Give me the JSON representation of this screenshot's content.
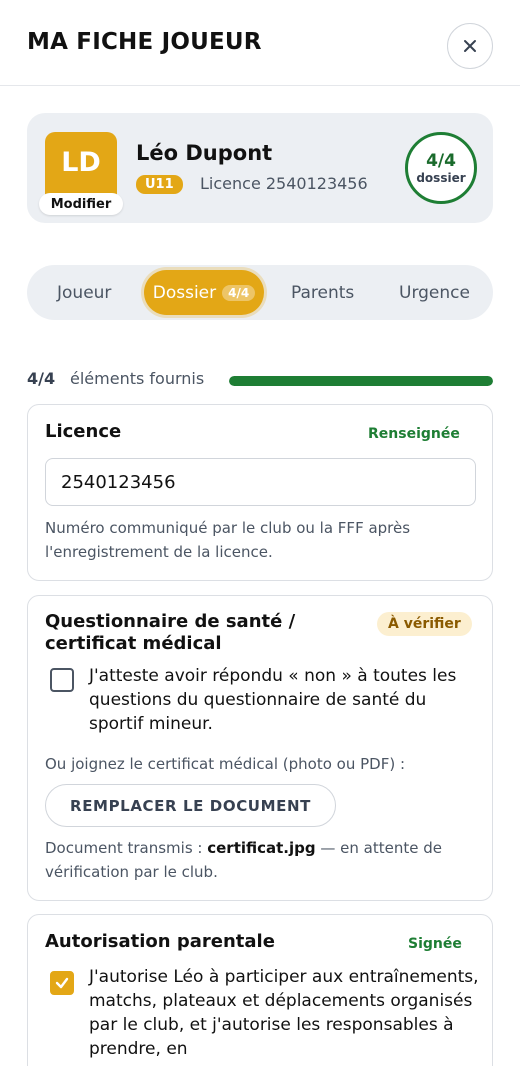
{
  "header": {
    "title": "MA FICHE JOUEUR",
    "close_icon": "close-icon"
  },
  "player": {
    "initials": "LD",
    "modify_label": "Modifier",
    "name": "Léo Dupont",
    "category": "U11",
    "licence_text": "Licence 2540123456",
    "progress_count": "4/4",
    "progress_label": "dossier"
  },
  "tabs": [
    {
      "label": "Joueur"
    },
    {
      "label": "Dossier",
      "count": "4/4",
      "active": true
    },
    {
      "label": "Parents"
    },
    {
      "label": "Urgence"
    }
  ],
  "progress": {
    "count": "4/4",
    "label": "éléments fournis",
    "fraction": 1.0
  },
  "licence_card": {
    "title": "Licence",
    "status": "Renseignée",
    "value": "2540123456",
    "help": "Numéro communiqué par le club ou la FFF après l'enregistrement de la licence."
  },
  "health_card": {
    "title_line1": "Questionnaire de santé /",
    "title_line2": "certificat médical",
    "status": "À vérifier",
    "checkbox_label": "J'atteste avoir répondu « non » à toutes les questions du questionnaire de santé du sportif mineur.",
    "checked": false,
    "or_text": "Ou joignez le certificat médical (photo ou PDF) :",
    "replace_label": "REMPLACER LE DOCUMENT",
    "doc_prefix": "Document transmis : ",
    "doc_name": "certificat.jpg",
    "doc_suffix": " — en attente de vérification par le club."
  },
  "parental_card": {
    "title": "Autorisation parentale",
    "status": "Signée",
    "checked": true,
    "checkbox_label": "J'autorise Léo à participer aux entraînements, matchs, plateaux et déplacements organisés par le club, et j'autorise les responsables à prendre, en"
  },
  "colors": {
    "accent": "#e3a716",
    "success": "#1e7e34",
    "warning_bg": "#fcefd0",
    "warning_text": "#8a5a00"
  }
}
